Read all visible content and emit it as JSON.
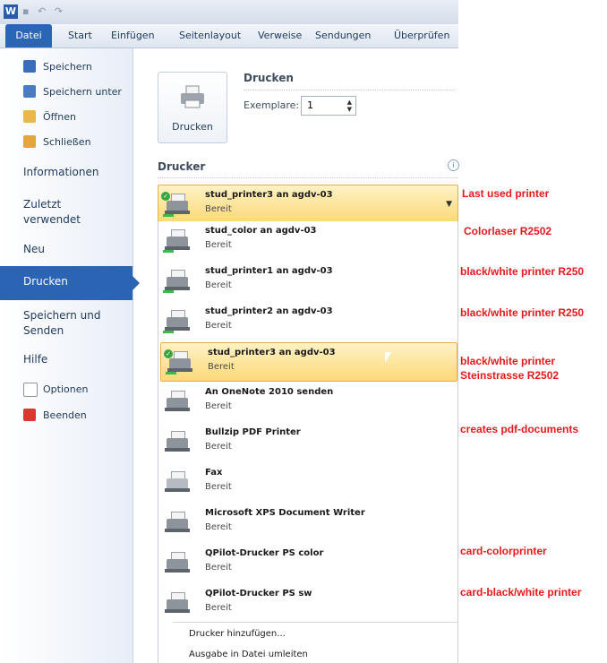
{
  "titlebar": {
    "app_icon": "W"
  },
  "ribbon_tabs": [
    "Datei",
    "Start",
    "Einfügen",
    "Seitenlayout",
    "Verweise",
    "Sendungen",
    "Überprüfen"
  ],
  "nav": {
    "commands": [
      "Speichern",
      "Speichern unter",
      "Öffnen",
      "Schließen"
    ],
    "informationen": "Informationen",
    "zuletzt": "Zuletzt verwendet",
    "neu": "Neu",
    "drucken": "Drucken",
    "speichern_senden": "Speichern und Senden",
    "hilfe": "Hilfe",
    "optionen": "Optionen",
    "beenden": "Beenden"
  },
  "print": {
    "button_label": "Drucken",
    "heading": "Drucken",
    "copies_label": "Exemplare:",
    "copies_value": "1",
    "printer_heading": "Drucker",
    "info_icon": "i"
  },
  "selected_printer": {
    "name": "stud_printer3 an agdv-03",
    "status": "Bereit"
  },
  "printers": [
    {
      "name": "stud_color an agdv-03",
      "status": "Bereit"
    },
    {
      "name": "stud_printer1 an agdv-03",
      "status": "Bereit"
    },
    {
      "name": "stud_printer2 an agdv-03",
      "status": "Bereit"
    },
    {
      "name": "stud_printer3 an agdv-03",
      "status": "Bereit"
    },
    {
      "name": "An OneNote 2010 senden",
      "status": "Bereit"
    },
    {
      "name": "Bullzip PDF Printer",
      "status": "Bereit"
    },
    {
      "name": "Fax",
      "status": "Bereit"
    },
    {
      "name": "Microsoft XPS Document Writer",
      "status": "Bereit"
    },
    {
      "name": "QPilot-Drucker PS color",
      "status": "Bereit"
    },
    {
      "name": "QPilot-Drucker PS sw",
      "status": "Bereit"
    }
  ],
  "list_actions": [
    "Drucker hinzufügen...",
    "Ausgabe in Datei umleiten"
  ],
  "annotations": {
    "last_used": "Last used printer",
    "color": "Colorlaser R2502",
    "bw1": "black/white printer R250",
    "bw2": "black/white printer R250",
    "bw3_line1": "black/white printer",
    "bw3_line2": "Steinstrasse R2502",
    "pdf": "creates pdf-documents",
    "card_color": "card-colorprinter",
    "card_bw": "card-black/white printer"
  },
  "colors": {
    "accent": "#2a64b2",
    "highlight": "#fbd97a",
    "annotation": "#e8181c"
  }
}
